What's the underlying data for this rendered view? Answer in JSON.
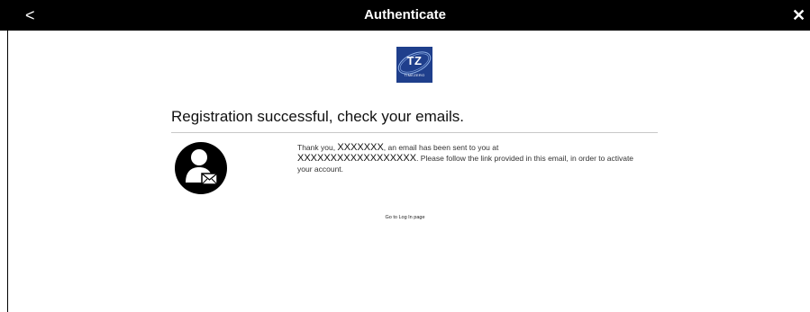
{
  "window": {
    "title": "Authenticate",
    "back_glyph": "<",
    "close_glyph": "✕"
  },
  "logo": {
    "mark": "TZ",
    "wordmark": "TIMEZERO",
    "color": "#1f3f8c"
  },
  "main": {
    "heading": "Registration successful, check your emails.",
    "message": {
      "part1": "Thank you, ",
      "name": "XXXXXXX",
      "part2": ", an email has been sent to you at",
      "email": "XXXXXXXXXXXXXXXXXX",
      "part3": ". Please follow the link provided in this email, in order to activate your account."
    },
    "login_link": "Go to Log In page",
    "avatar_icon": "user-mail-icon"
  }
}
